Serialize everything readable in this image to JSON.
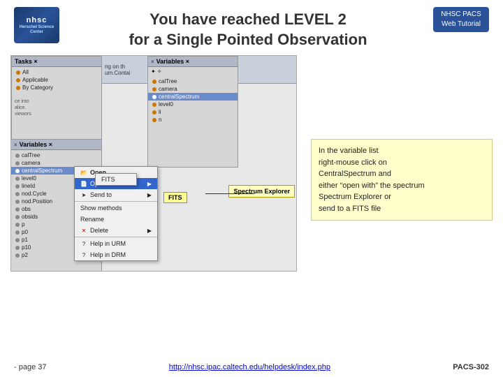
{
  "header": {
    "title_line1": "You have reached LEVEL 2",
    "title_line2": "for a Single Pointed Observation",
    "badge_line1": "NHSC PACS",
    "badge_line2": "Web Tutorial"
  },
  "logo": {
    "line1": "nhsc",
    "line2": "Herschel Science Center"
  },
  "screenshot": {
    "tasks_title": "Tasks ×",
    "tasks_items": [
      "All",
      "Applicable",
      "By Category"
    ],
    "variables_title": "Variables ×",
    "variables_items": [
      "calTree",
      "camera",
      "centralSpectrum",
      "level0",
      "lineId",
      "nod.Cycle",
      "nod.Position",
      "obs",
      "obsids",
      "p",
      "p0",
      "p1",
      "p10",
      "p2"
    ],
    "selected_var": "centralSpectrum",
    "context_menu": {
      "items": [
        "Open",
        "Open With",
        "Send to",
        "Show methods",
        "Rename",
        "Delete",
        "Help in URM",
        "Help in DRM"
      ]
    },
    "submenu_item": "FITS",
    "fits_label": "FITS",
    "spectrum_label": "Spectrum Explorer"
  },
  "info_box": {
    "line1": "In the variable list",
    "line2": "right-mouse click on",
    "line3": "CentralSpectrum and",
    "line4": "either “open with” the spectrum",
    "line5": "Spectrum Explorer or",
    "line6": "send to a FITS file"
  },
  "footer": {
    "page_label": "- page 37",
    "url": "http://nhsc.ipac.caltech.edu/helpdesk/index.php",
    "code": "PACS-302"
  }
}
